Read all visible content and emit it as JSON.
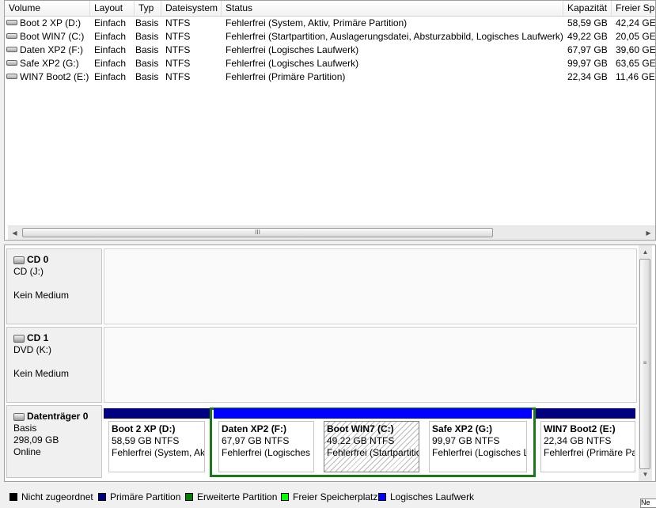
{
  "columns": [
    "Volume",
    "Layout",
    "Typ",
    "Dateisystem",
    "Status",
    "Kapazität",
    "Freier Sp"
  ],
  "volumes": [
    {
      "name": "Boot 2 XP (D:)",
      "layout": "Einfach",
      "type": "Basis",
      "fs": "NTFS",
      "status": "Fehlerfrei (System, Aktiv, Primäre Partition)",
      "capacity": "58,59 GB",
      "free": "42,24 GE"
    },
    {
      "name": "Boot WIN7 (C:)",
      "layout": "Einfach",
      "type": "Basis",
      "fs": "NTFS",
      "status": "Fehlerfrei (Startpartition, Auslagerungsdatei, Absturzabbild, Logisches Laufwerk)",
      "capacity": "49,22 GB",
      "free": "20,05 GE"
    },
    {
      "name": "Daten XP2 (F:)",
      "layout": "Einfach",
      "type": "Basis",
      "fs": "NTFS",
      "status": "Fehlerfrei (Logisches Laufwerk)",
      "capacity": "67,97 GB",
      "free": "39,60 GE"
    },
    {
      "name": "Safe XP2 (G:)",
      "layout": "Einfach",
      "type": "Basis",
      "fs": "NTFS",
      "status": "Fehlerfrei (Logisches Laufwerk)",
      "capacity": "99,97 GB",
      "free": "63,65 GE"
    },
    {
      "name": "WIN7 Boot2 (E:)",
      "layout": "Einfach",
      "type": "Basis",
      "fs": "NTFS",
      "status": "Fehlerfrei (Primäre Partition)",
      "capacity": "22,34 GB",
      "free": "11,46 GE"
    }
  ],
  "scroll_grip": "III",
  "disks": [
    {
      "name": "CD 0",
      "line1": "CD (J:)",
      "line2": "",
      "line3": "Kein Medium"
    },
    {
      "name": "CD 1",
      "line1": "DVD (K:)",
      "line2": "",
      "line3": "Kein Medium"
    },
    {
      "name": "Datenträger 0",
      "line1": "Basis",
      "line2": "298,09 GB",
      "line3": "Online"
    }
  ],
  "partitions": [
    {
      "title": "Boot 2 XP  (D:)",
      "size": "58,59 GB NTFS",
      "status": "Fehlerfrei (System, Aktiv, Primäre Partition)",
      "bar_color": "#000080",
      "selected": false
    },
    {
      "title": "Daten XP2  (F:)",
      "size": "67,97 GB NTFS",
      "status": "Fehlerfrei (Logisches Laufwerk)",
      "bar_color": "#0000ff",
      "selected": false
    },
    {
      "title": "Boot WIN7  (C:)",
      "size": "49,22 GB NTFS",
      "status": "Fehlerfrei (Startpartition, Auslagerungsdatei, Absturzabbild, Logisches Laufwerk)",
      "bar_color": "#0000ff",
      "selected": true
    },
    {
      "title": "Safe XP2  (G:)",
      "size": "99,97 GB NTFS",
      "status": "Fehlerfrei (Logisches Laufwerk)",
      "bar_color": "#0000ff",
      "selected": false
    },
    {
      "title": "WIN7 Boot2  (E:)",
      "size": "22,34 GB NTFS",
      "status": "Fehlerfrei (Primäre Partition)",
      "bar_color": "#000080",
      "selected": false
    }
  ],
  "legend": [
    {
      "label": "Nicht zugeordnet",
      "color": "#000000"
    },
    {
      "label": "Primäre Partition",
      "color": "#000080"
    },
    {
      "label": "Erweiterte Partition",
      "color": "#008000"
    },
    {
      "label": "Freier Speicherplatz",
      "color": "#00ff00"
    },
    {
      "label": "Logisches Laufwerk",
      "color": "#0000ff"
    }
  ],
  "tooltip_fragment": "Ne"
}
